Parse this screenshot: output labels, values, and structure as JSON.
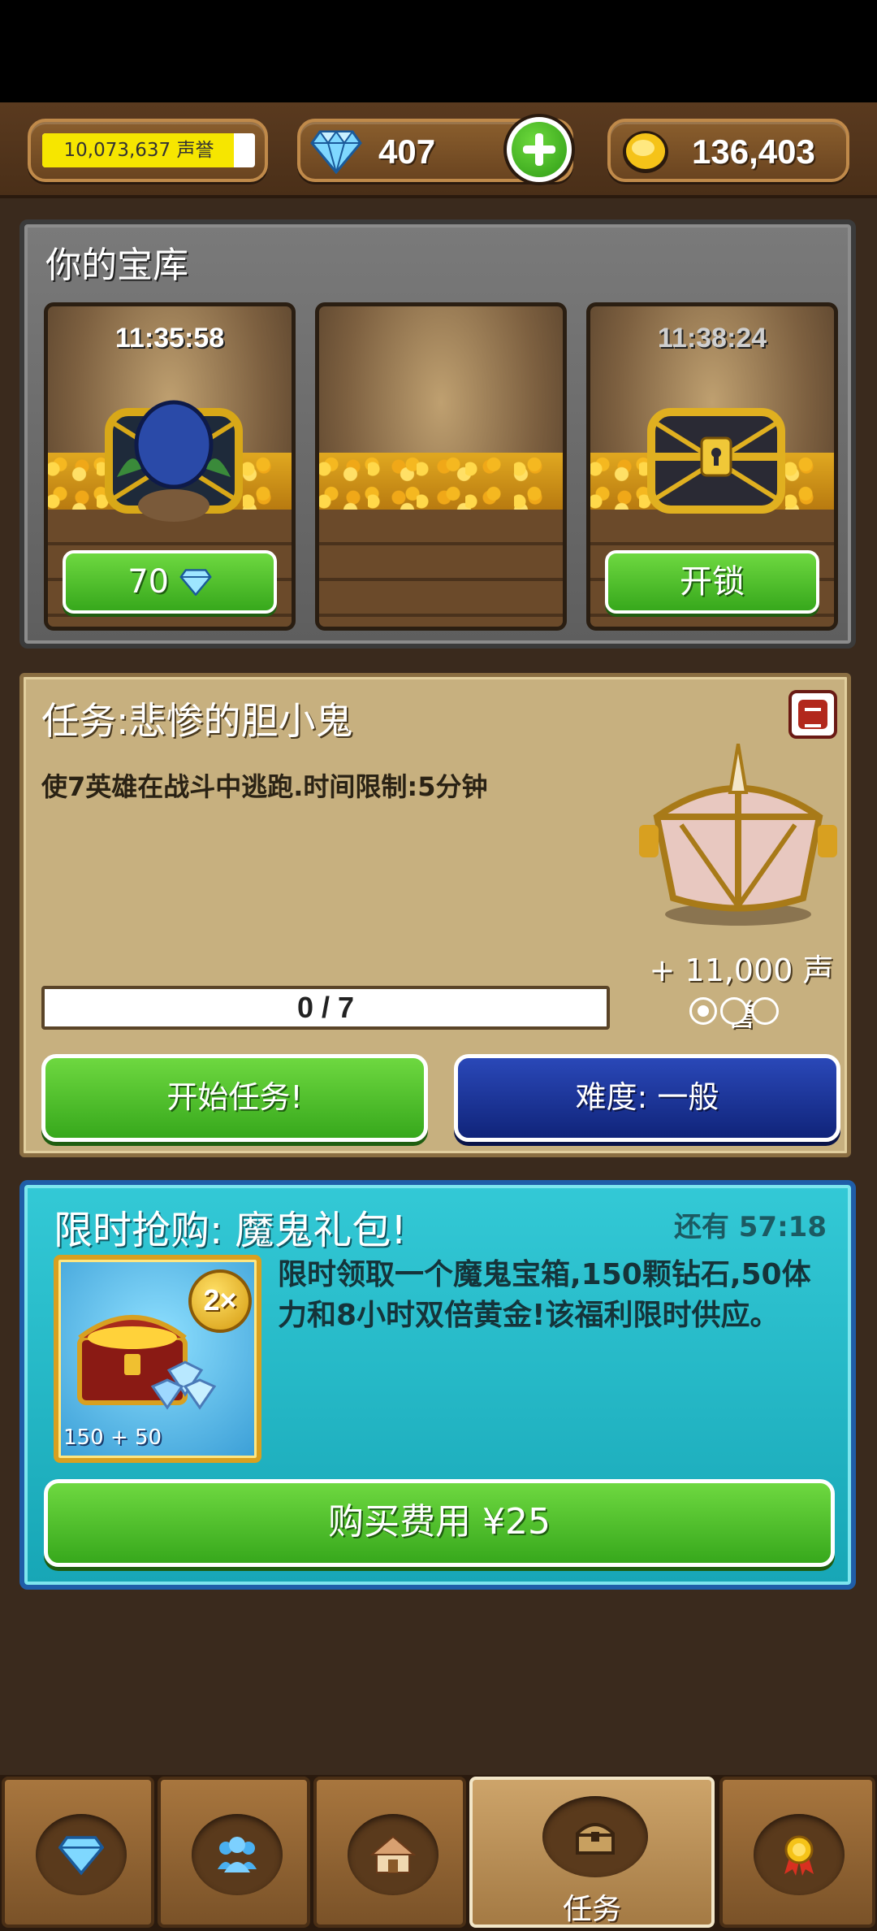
{
  "header": {
    "fame": "10,073,637 声誉",
    "fame_progress": 0.9,
    "gems": "407",
    "gold": "136,403"
  },
  "treasury": {
    "title": "你的宝库",
    "slots": [
      {
        "timer": "11:35:58",
        "button": "70",
        "button_icon": "gem-icon",
        "state": "unlocking"
      },
      {
        "timer": "",
        "button": "",
        "state": "empty"
      },
      {
        "timer": "11:38:24",
        "button": "开锁",
        "state": "locked"
      }
    ]
  },
  "quest": {
    "title": "任务:悲惨的胆小鬼",
    "description": "使7英雄在战斗中逃跑.时间限制:5分钟",
    "reward": "+ 11,000 声誉",
    "progress_text": "0 / 7",
    "progress_fraction": 0,
    "difficulty_dots_filled": 1,
    "difficulty_dots_total": 3,
    "start_button": "开始任务!",
    "difficulty_button": "难度: 一般"
  },
  "offer": {
    "title": "限时抢购: 魔鬼礼包!",
    "timer": "还有 57:18",
    "badge": "2×",
    "image_caption": "150 + 50",
    "description": "限时领取一个魔鬼宝箱,150颗钻石,50体力和8小时双倍黄金!该福利限时供应。",
    "buy_button": "购买费用 ¥25"
  },
  "nav": {
    "tabs": [
      {
        "icon": "gem-icon",
        "label": ""
      },
      {
        "icon": "people-icon",
        "label": ""
      },
      {
        "icon": "house-icon",
        "label": ""
      },
      {
        "icon": "chest-icon",
        "label": "任务",
        "active": true
      },
      {
        "icon": "medal-icon",
        "label": ""
      }
    ]
  },
  "colors": {
    "green_button": "#37a81c",
    "blue_button": "#10247a",
    "offer_bg": "#17a6b6",
    "quest_bg": "#c7b07f"
  }
}
